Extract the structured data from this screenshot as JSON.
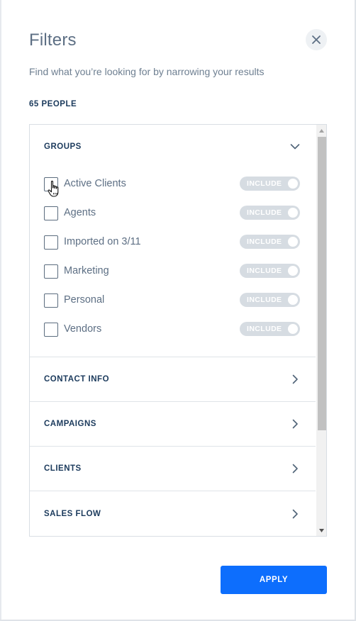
{
  "panel": {
    "title": "Filters",
    "subtitle": "Find what you’re looking for by narrowing your results",
    "count_label": "65 PEOPLE"
  },
  "groups": {
    "label": "GROUPS",
    "expanded": true,
    "items": [
      {
        "label": "Active Clients",
        "checked": false,
        "toggle_label": "INCLUDE"
      },
      {
        "label": "Agents",
        "checked": false,
        "toggle_label": "INCLUDE"
      },
      {
        "label": "Imported on 3/11",
        "checked": false,
        "toggle_label": "INCLUDE"
      },
      {
        "label": "Marketing",
        "checked": false,
        "toggle_label": "INCLUDE"
      },
      {
        "label": "Personal",
        "checked": false,
        "toggle_label": "INCLUDE"
      },
      {
        "label": "Vendors",
        "checked": false,
        "toggle_label": "INCLUDE"
      }
    ]
  },
  "sections": [
    {
      "label": "CONTACT INFO"
    },
    {
      "label": "CAMPAIGNS"
    },
    {
      "label": "CLIENTS"
    },
    {
      "label": "SALES FLOW"
    }
  ],
  "actions": {
    "apply_label": "APPLY"
  },
  "icons": {
    "close": "close-icon",
    "expand": "chevron-down-icon",
    "section": "chevron-right-icon",
    "cursor": "hand-pointer-icon"
  },
  "colors": {
    "accent": "#0d6efd",
    "heading": "#1b3a5c",
    "text": "#5d6f84",
    "toggle": "#d6dce2"
  }
}
